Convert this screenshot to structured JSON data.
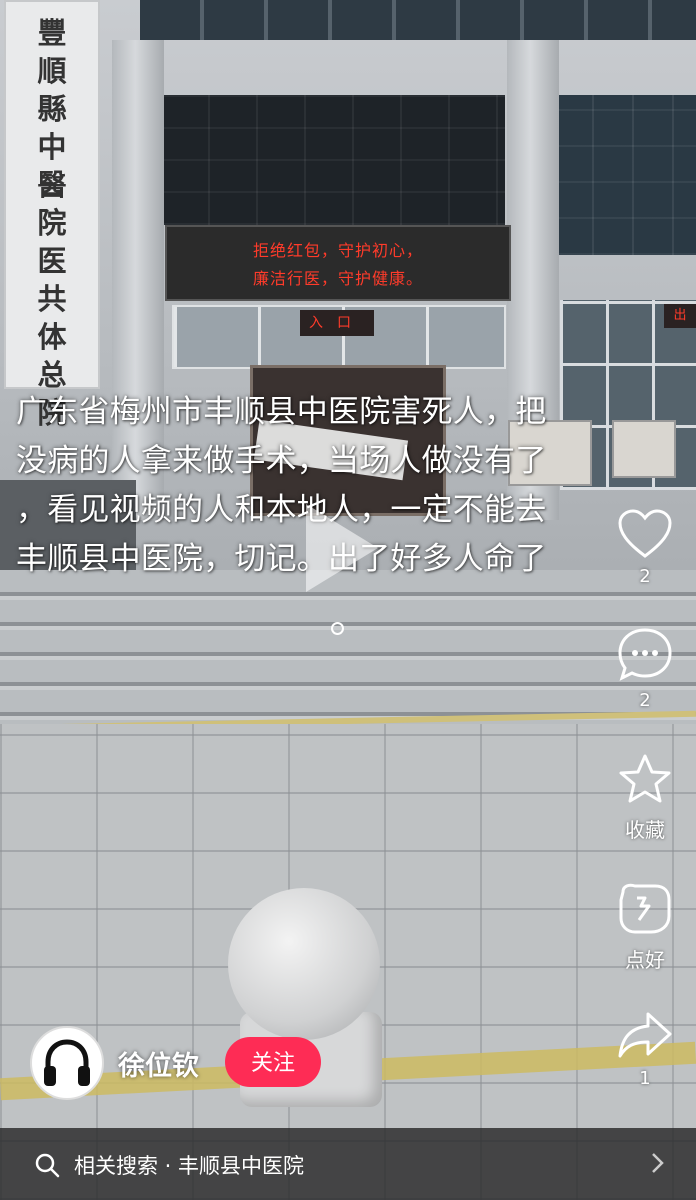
{
  "background": {
    "plaque_text": "豐順縣中醫院医共体总院",
    "led_line1": "拒绝红包，守护初心，",
    "led_line2": "廉洁行医，守护健康。",
    "entrance_sign": "入口",
    "exit_sign": "出"
  },
  "caption": {
    "lines": [
      "广东省梅州市丰顺县中医院害死人，把",
      "没病的人拿来做手术，当场人做没有了",
      "，看见视频的人和本地人，一定不能去",
      "丰顺县中医院，切记。出了好多人命了"
    ]
  },
  "actions": {
    "like": {
      "icon": "heart-icon",
      "count": "2"
    },
    "comment": {
      "icon": "comment-icon",
      "count": "2"
    },
    "favorite": {
      "icon": "star-icon",
      "label": "收藏"
    },
    "recommend": {
      "icon": "recommend-icon",
      "label": "点好"
    },
    "share": {
      "icon": "share-icon",
      "count": "1"
    }
  },
  "author": {
    "name": "徐位钦",
    "follow_label": "关注",
    "avatar_icon": "headphones-icon"
  },
  "search": {
    "label": "相关搜索 · 丰顺县中医院"
  },
  "colors": {
    "accent": "#fe2c55",
    "led": "#ff3b2a"
  }
}
